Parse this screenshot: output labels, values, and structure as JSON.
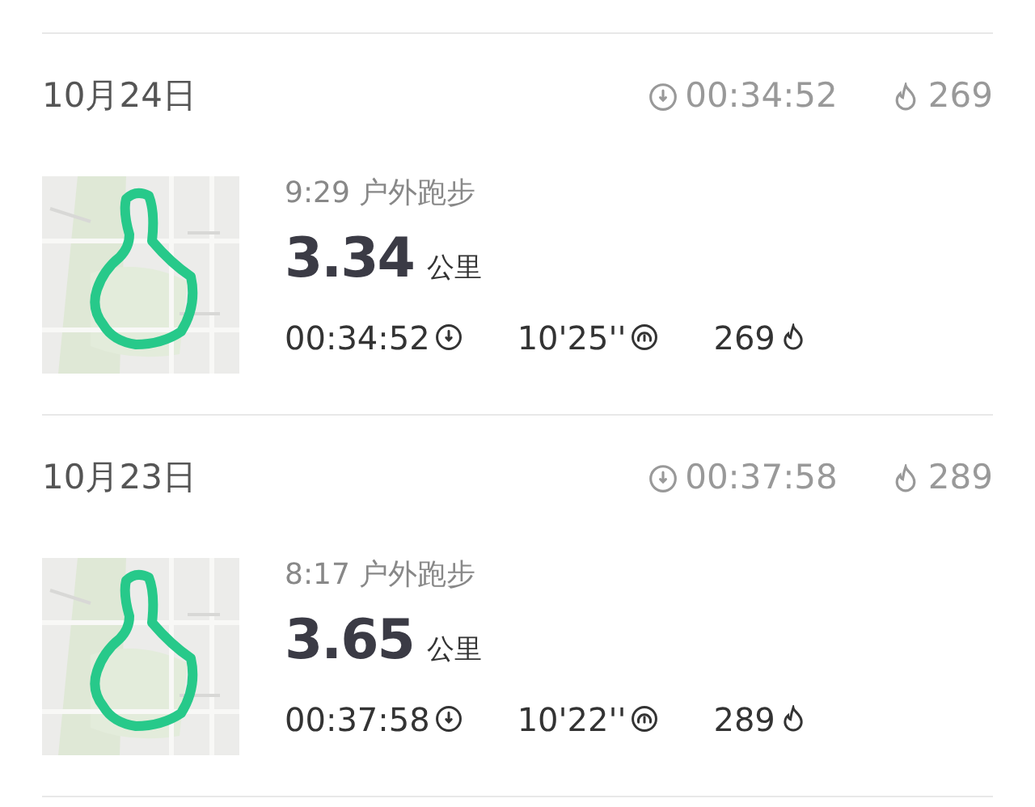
{
  "days": [
    {
      "date": "10月24日",
      "duration": "00:34:52",
      "calories": "269",
      "activities": [
        {
          "kind": "picture",
          "title": "9:29 户外跑步",
          "distance": "3.34",
          "unit": "公里",
          "duration": "00:34:52",
          "pace": "10'25''",
          "calories": "269"
        }
      ]
    },
    {
      "date": "10月23日",
      "duration": "00:37:58",
      "calories": "289",
      "activities": [
        {
          "kind": "picture",
          "title": "8:17 户外跑步",
          "distance": "3.65",
          "unit": "公里",
          "duration": "00:37:58",
          "pace": "10'22''",
          "calories": "289"
        }
      ]
    }
  ]
}
